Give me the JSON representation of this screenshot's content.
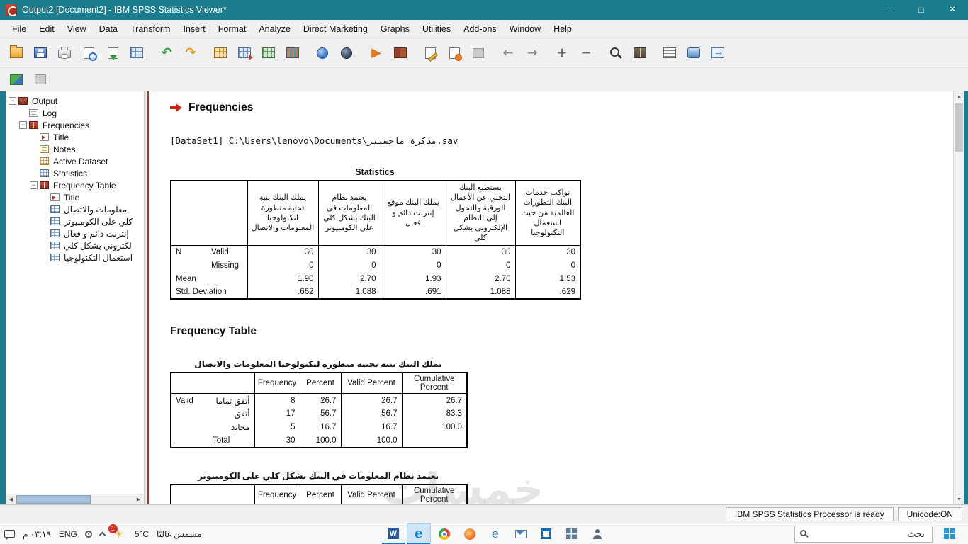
{
  "window": {
    "title": "Output2 [Document2] - IBM SPSS Statistics Viewer*"
  },
  "menu": {
    "items": [
      "File",
      "Edit",
      "View",
      "Data",
      "Transform",
      "Insert",
      "Format",
      "Analyze",
      "Direct Marketing",
      "Graphs",
      "Utilities",
      "Add-ons",
      "Window",
      "Help"
    ]
  },
  "toolbar": {
    "main": [
      "open",
      "save",
      "print",
      "print-preview",
      "export",
      "recall-dialogs",
      "sep",
      "undo",
      "redo",
      "sep",
      "goto-case",
      "goto-variable",
      "variables",
      "value-labels",
      "sep",
      "find",
      "replace",
      "sep",
      "select-last-output",
      "designate-window",
      "sep",
      "insert-heading",
      "insert-title",
      "insert-text",
      "sep",
      "promote",
      "demote",
      "sep",
      "expand",
      "collapse",
      "sep",
      "show",
      "hide",
      "sep",
      "outline-size",
      "activate-ole",
      "run-script"
    ],
    "secondary": [
      "goto-data",
      "blank"
    ]
  },
  "tree": {
    "items": [
      {
        "label": "Output",
        "icon": "book-red",
        "level": 0,
        "expand": true
      },
      {
        "label": "Log",
        "icon": "page-log",
        "level": 1
      },
      {
        "label": "Frequencies",
        "icon": "book-red",
        "level": 1,
        "expand": true
      },
      {
        "label": "Title",
        "icon": "title",
        "level": 2
      },
      {
        "label": "Notes",
        "icon": "notes",
        "level": 2
      },
      {
        "label": "Active Dataset",
        "icon": "dataset",
        "level": 2
      },
      {
        "label": "Statistics",
        "icon": "table",
        "level": 2
      },
      {
        "label": "Frequency Table",
        "icon": "book-red",
        "level": 2,
        "expand": true
      },
      {
        "label": "Title",
        "icon": "title",
        "level": 3
      },
      {
        "label": "معلومات والاتصال",
        "icon": "table",
        "level": 3,
        "rtl": true
      },
      {
        "label": "كلي على الكومبيوتر",
        "icon": "table",
        "level": 3,
        "rtl": true
      },
      {
        "label": "إنترنت دائم و فعال",
        "icon": "table",
        "level": 3,
        "rtl": true
      },
      {
        "label": "لكتروني بشكل كلي",
        "icon": "table",
        "level": 3,
        "rtl": true
      },
      {
        "label": "استعمال التكنولوجيا",
        "icon": "table",
        "level": 3,
        "rtl": true
      }
    ]
  },
  "content": {
    "heading": "Frequencies",
    "dataset_line": "[DataSet1] C:\\Users\\lenovo\\Documents\\مذكرة ماجستير.sav",
    "stats": {
      "caption": "Statistics",
      "col_headers": [
        "يملك البنك بنية تحتية متطورة لتكنولوجيا المعلومات والاتصال",
        "يعتمد نظام المعلومات في البنك بشكل كلي على الكومبيوتر",
        "يملك البنك موقع إنترنت دائم و فعال",
        "يستطيع البنك التخلي عن الأعمال الورقية والتحول إلى النظام الإلكتروني بشكل كلي",
        "تواكب خدمات البنك التطورات العالمية من حيث استعمال التكنولوجيا"
      ],
      "rows": [
        {
          "label": "N",
          "sub": "Valid",
          "v": [
            "30",
            "30",
            "30",
            "30",
            "30"
          ]
        },
        {
          "label": "",
          "sub": "Missing",
          "v": [
            "0",
            "0",
            "0",
            "0",
            "0"
          ]
        },
        {
          "label": "Mean",
          "sub": "",
          "v": [
            "1.90",
            "2.70",
            "1.93",
            "2.70",
            "1.53"
          ]
        },
        {
          "label": "Std. Deviation",
          "sub": "",
          "v": [
            ".662",
            "1.088",
            ".691",
            "1.088",
            ".629"
          ]
        }
      ]
    },
    "freq_heading": "Frequency Table",
    "freq1": {
      "title": "يملك البنك بنية تحتية متطورة لتكنولوجيا المعلومات والاتصال",
      "headers": [
        "Frequency",
        "Percent",
        "Valid Percent",
        "Cumulative Percent"
      ],
      "stub": "Valid",
      "rows": [
        {
          "label": "أتفق تماما",
          "v": [
            "8",
            "26.7",
            "26.7",
            "26.7"
          ]
        },
        {
          "label": "أتفق",
          "v": [
            "17",
            "56.7",
            "56.7",
            "83.3"
          ]
        },
        {
          "label": "محايد",
          "v": [
            "5",
            "16.7",
            "16.7",
            "100.0"
          ]
        },
        {
          "label": "Total",
          "v": [
            "30",
            "100.0",
            "100.0",
            ""
          ]
        }
      ]
    },
    "freq2": {
      "title": "يعتمد نظام المعلومات في البنك بشكل كلي على الكومبيوتر",
      "headers": [
        "Frequency",
        "Percent",
        "Valid Percent",
        "Cumulative Percent"
      ]
    }
  },
  "status": {
    "processor": "IBM SPSS Statistics Processor is ready",
    "unicode": "Unicode:ON"
  },
  "taskbar": {
    "tray": {
      "time": "٠٣:١٩ م",
      "lang": "ENG",
      "badge": "1",
      "temp": "5°C",
      "weather": "مشمس غالبًا"
    },
    "apps": [
      {
        "name": "word",
        "active": true
      },
      {
        "name": "edge",
        "active": true,
        "highlight": true
      },
      {
        "name": "chrome"
      },
      {
        "name": "firefox"
      },
      {
        "name": "ie"
      },
      {
        "name": "mail"
      },
      {
        "name": "store"
      },
      {
        "name": "apps"
      },
      {
        "name": "people"
      }
    ],
    "search": "بحث"
  },
  "watermark": "خمسات"
}
